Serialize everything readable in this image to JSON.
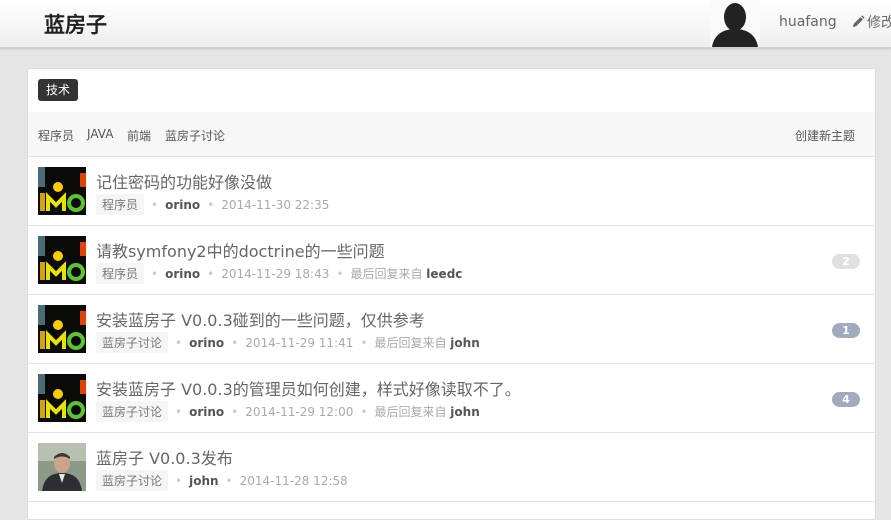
{
  "header": {
    "brand": "蓝房子",
    "username": "huafang",
    "edit_label": "修改"
  },
  "panel": {
    "tag": "技术",
    "nav": [
      "程序员",
      "JAVA",
      "前端",
      "蓝房子讨论"
    ],
    "create_label": "创建新主题"
  },
  "topics": [
    {
      "title": "记住密码的功能好像没做",
      "category": "程序员",
      "author": "orino",
      "time": "2014-11-30 22:35",
      "last_reply_label": "",
      "last_reply_user": "",
      "replies": ""
    },
    {
      "title": "请教symfony2中的doctrine的一些问题",
      "category": "程序员",
      "author": "orino",
      "time": "2014-11-29 18:43",
      "last_reply_label": "最后回复来自",
      "last_reply_user": "leedc",
      "replies": "2"
    },
    {
      "title": "安装蓝房子 V0.0.3碰到的一些问题，仅供参考",
      "category": "蓝房子讨论",
      "author": "orino",
      "time": "2014-11-29 11:41",
      "last_reply_label": "最后回复来自",
      "last_reply_user": "john",
      "replies": "1"
    },
    {
      "title": "安装蓝房子 V0.0.3的管理员如何创建，样式好像读取不了。",
      "category": "蓝房子讨论",
      "author": "orino",
      "time": "2014-11-29 12:00",
      "last_reply_label": "最后回复来自",
      "last_reply_user": "john",
      "replies": "4"
    },
    {
      "title": "蓝房子 V0.0.3发布",
      "category": "蓝房子讨论",
      "author": "john",
      "time": "2014-11-28 12:58",
      "last_reply_label": "",
      "last_reply_user": "",
      "replies": ""
    }
  ],
  "colors": {
    "badge_light": "#e0e0e0",
    "badge_active": "#a3aabd"
  }
}
